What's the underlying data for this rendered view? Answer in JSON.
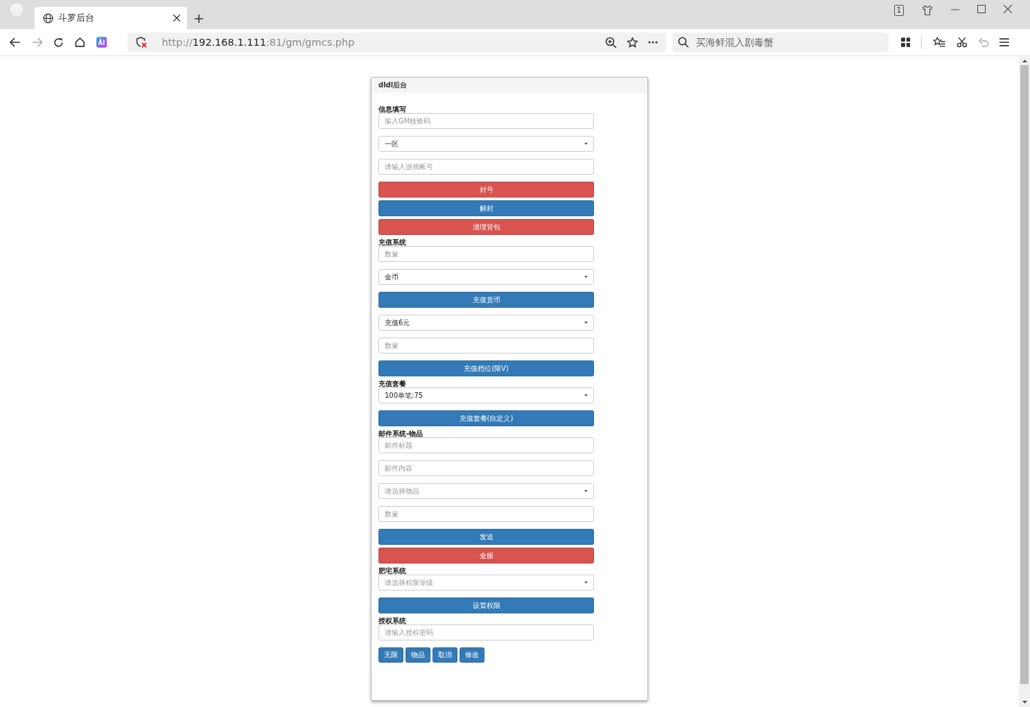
{
  "browser": {
    "tabs": [
      {
        "title": "斗罗后台",
        "selected": true
      }
    ],
    "tab_count": "1",
    "url": {
      "scheme": "http://",
      "host": "192.168.1.111",
      "path": ":81/gm/gmcs.php"
    },
    "search": {
      "placeholder": "买海鲜混入剧毒蟹"
    }
  },
  "panel": {
    "title": "dldl后台",
    "items": [
      {
        "kind": "label",
        "text": "信息填写"
      },
      {
        "kind": "input",
        "placeholder": "输入GM校验码"
      },
      {
        "kind": "select",
        "value": "一区"
      },
      {
        "kind": "input",
        "placeholder": "请输入游戏帐号"
      },
      {
        "kind": "button",
        "text": "封号",
        "color": "#d9534f"
      },
      {
        "kind": "button",
        "text": "解封",
        "color": "#337ab7"
      },
      {
        "kind": "button",
        "text": "清理背包",
        "color": "#d9534f"
      },
      {
        "kind": "label",
        "text": "充值系统"
      },
      {
        "kind": "input",
        "placeholder": "数量"
      },
      {
        "kind": "select",
        "value": "金币"
      },
      {
        "kind": "button",
        "text": "充值货币",
        "color": "#337ab7"
      },
      {
        "kind": "select",
        "value": "充值6元"
      },
      {
        "kind": "input",
        "placeholder": "数量"
      },
      {
        "kind": "button",
        "text": "充值档位(限V)",
        "color": "#337ab7"
      },
      {
        "kind": "label",
        "text": "充值套餐"
      },
      {
        "kind": "select",
        "value": "100单笔:75"
      },
      {
        "kind": "button",
        "text": "充值套餐(自定义)",
        "color": "#337ab7"
      },
      {
        "kind": "label",
        "text": "邮件系统-物品"
      },
      {
        "kind": "input",
        "placeholder": "邮件标题"
      },
      {
        "kind": "input",
        "placeholder": "邮件内容"
      },
      {
        "kind": "select",
        "placeholder": "请选择物品"
      },
      {
        "kind": "input",
        "placeholder": "数量"
      },
      {
        "kind": "button",
        "text": "发送",
        "color": "#337ab7"
      },
      {
        "kind": "button",
        "text": "全服",
        "color": "#d9534f"
      },
      {
        "kind": "label",
        "text": "肥宅系统"
      },
      {
        "kind": "select",
        "placeholder": "请选择权限等级"
      },
      {
        "kind": "button",
        "text": "设置权限",
        "color": "#337ab7"
      },
      {
        "kind": "label",
        "text": "授权系统"
      },
      {
        "kind": "input",
        "placeholder": "请输入授权密码"
      },
      {
        "kind": "button_row",
        "buttons": [
          {
            "text": "无限",
            "color": "#337ab7"
          },
          {
            "text": "物品",
            "color": "#337ab7"
          },
          {
            "text": "取消",
            "color": "#337ab7"
          },
          {
            "text": "修改",
            "color": "#337ab7"
          }
        ]
      }
    ]
  }
}
